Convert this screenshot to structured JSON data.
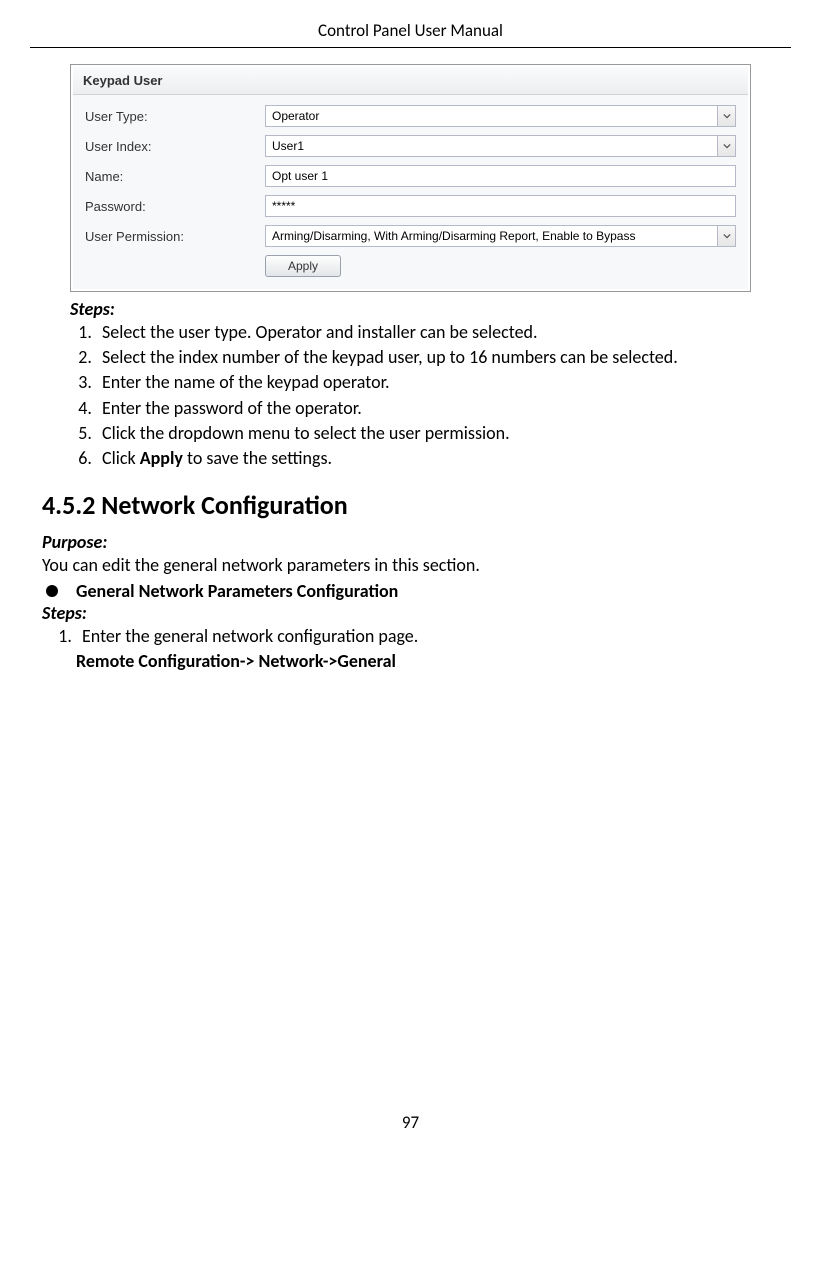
{
  "header": {
    "title": "Control Panel User Manual"
  },
  "panel": {
    "title": "Keypad User",
    "rows": {
      "userType": {
        "label": "User Type:",
        "value": "Operator"
      },
      "userIndex": {
        "label": "User Index:",
        "value": "User1"
      },
      "name": {
        "label": "Name:",
        "value": "Opt user 1"
      },
      "password": {
        "label": "Password:",
        "value": "*****"
      },
      "permission": {
        "label": "User Permission:",
        "value": "Arming/Disarming, With Arming/Disarming Report, Enable to Bypass"
      }
    },
    "applyLabel": "Apply"
  },
  "stepsLabel": "Steps:",
  "steps": [
    "Select the user type. Operator and installer can be selected.",
    "Select the index number of the keypad user, up to 16 numbers can be selected.",
    "Enter the name of the keypad operator.",
    "Enter the password of the operator.",
    "Click the dropdown menu to select the user permission."
  ],
  "step6Prefix": "Click ",
  "step6Bold": "Apply",
  "step6Suffix": " to save the settings.",
  "sectionTitle": "4.5.2   Network Configuration",
  "purposeLabel": "Purpose:",
  "purposeText": "You can edit the general network parameters in this section.",
  "bulletTitle": "General Network Parameters Configuration",
  "stepsLabel2": "Steps:",
  "steps2": [
    "Enter the general network configuration page."
  ],
  "pathText": "Remote Configuration-> Network->General",
  "pageNumber": "97"
}
